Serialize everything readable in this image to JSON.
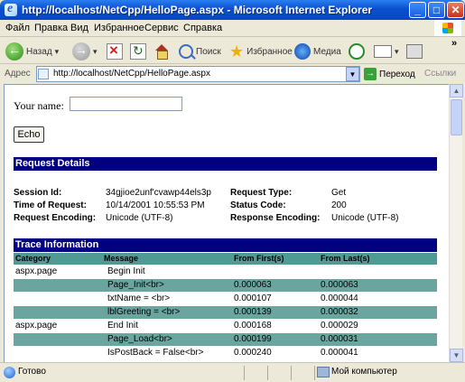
{
  "window": {
    "title": "http://localhost/NetCpp/HelloPage.aspx - Microsoft Internet Explorer",
    "minimize": "_",
    "maximize": "□",
    "close": "✕"
  },
  "menu": [
    "Файл",
    "Правка",
    "Вид",
    "Избранное",
    "Сервис",
    "Справка"
  ],
  "toolbar": {
    "back": "Назад",
    "search": "Поиск",
    "favorites": "Избранное",
    "media": "Медиа",
    "more": "»"
  },
  "address": {
    "label": "Адрес",
    "url": "http://localhost/NetCpp/HelloPage.aspx",
    "go": "Переход",
    "links": "Ссылки"
  },
  "form": {
    "name_label": "Your name:",
    "name_value": "",
    "echo_label": "Echo"
  },
  "request_details": {
    "header": "Request Details",
    "session_id_label": "Session Id:",
    "session_id": "34gjioe2unf'cvawp44els3p",
    "request_type_label": "Request Type:",
    "request_type": "Get",
    "time_label": "Time of Request:",
    "time": "10/14/2001 10:55:53 PM",
    "status_code_label": "Status Code:",
    "status_code": "200",
    "request_encoding_label": "Request Encoding:",
    "request_encoding": "Unicode (UTF-8)",
    "response_encoding_label": "Response Encoding:",
    "response_encoding": "Unicode (UTF-8)"
  },
  "trace": {
    "header": "Trace Information",
    "columns": [
      "Category",
      "Message",
      "From First(s)",
      "From Last(s)"
    ],
    "rows": [
      {
        "category": "aspx.page",
        "message": "Begin Init",
        "first": "",
        "last": ""
      },
      {
        "category": "",
        "message": "Page_Init<br>",
        "first": "0.000063",
        "last": "0.000063"
      },
      {
        "category": "",
        "message": "txtName = <br>",
        "first": "0.000107",
        "last": "0.000044"
      },
      {
        "category": "",
        "message": "lblGreeting = <br>",
        "first": "0.000139",
        "last": "0.000032"
      },
      {
        "category": "aspx.page",
        "message": "End Init",
        "first": "0.000168",
        "last": "0.000029"
      },
      {
        "category": "",
        "message": "Page_Load<br>",
        "first": "0.000199",
        "last": "0.000031"
      },
      {
        "category": "",
        "message": "IsPostBack = False<br>",
        "first": "0.000240",
        "last": "0.000041"
      }
    ]
  },
  "status": {
    "text": "Готово",
    "zone": "Мой компьютер"
  }
}
